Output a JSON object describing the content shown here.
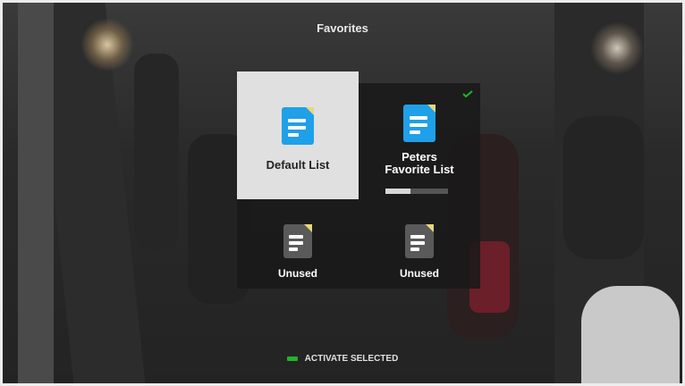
{
  "screen": {
    "title": "Favorites"
  },
  "lists": [
    {
      "label": "Default List",
      "selected": true,
      "icon": "document-icon",
      "color": "#1fa0e8"
    },
    {
      "label": "Peters Favorite List",
      "active": true,
      "icon": "document-icon",
      "color": "#1fa0e8",
      "progress": 0.4
    },
    {
      "label": "Unused",
      "icon": "document-icon",
      "color": "#5a5a5a"
    },
    {
      "label": "Unused",
      "icon": "document-icon",
      "color": "#5a5a5a"
    }
  ],
  "footer": {
    "action_label": "ACTIVATE SELECTED",
    "key_color": "#20b42a"
  }
}
